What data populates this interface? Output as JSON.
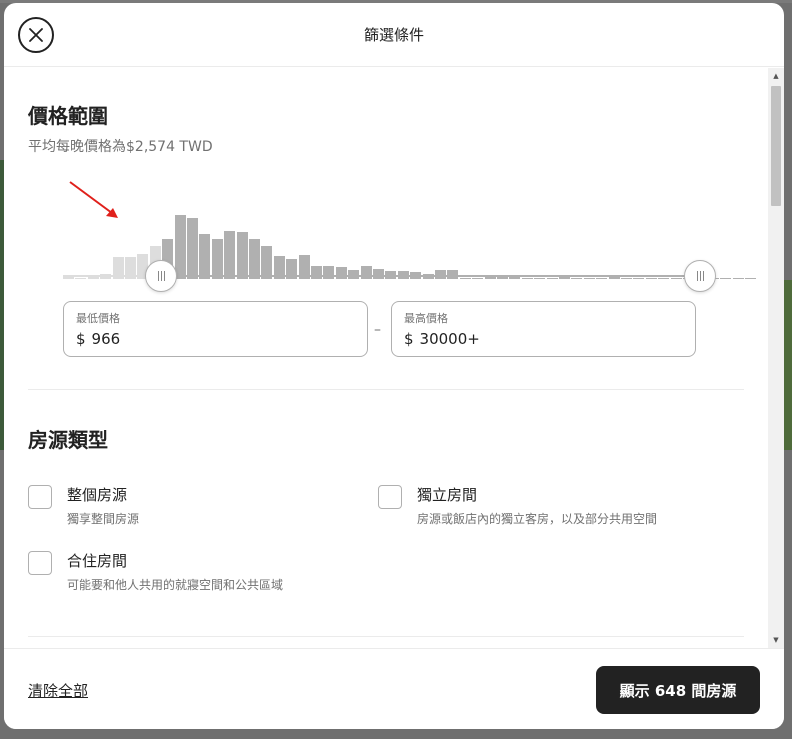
{
  "header": {
    "title": "篩選條件",
    "close_icon": "close-icon"
  },
  "price_range": {
    "title": "價格範圍",
    "subtitle": "平均每晚價格為$2,574 TWD",
    "histogram_heights": [
      2,
      1,
      3,
      5,
      22,
      22,
      25,
      33,
      40,
      64,
      61,
      45,
      40,
      48,
      47,
      40,
      33,
      23,
      20,
      24,
      13,
      13,
      12,
      9,
      13,
      10,
      8,
      8,
      7,
      5,
      9,
      9,
      1,
      1,
      2,
      2,
      3,
      1,
      1,
      1,
      2,
      1,
      1,
      1,
      2,
      1,
      1,
      1,
      1,
      1,
      1,
      1,
      1,
      1,
      1,
      1
    ],
    "histogram_excluded_count": 8,
    "min_label": "最低價格",
    "min_currency": "$",
    "min_value": "966",
    "separator": "–",
    "max_label": "最高價格",
    "max_currency": "$",
    "max_value": "30000+",
    "annotation_color": "#e0201b"
  },
  "property_type": {
    "title": "房源類型",
    "options": [
      {
        "label": "整個房源",
        "description": "獨享整間房源",
        "checked": false
      },
      {
        "label": "獨立房間",
        "description": "房源或飯店內的獨立客房，以及部分共用空間",
        "checked": false
      },
      {
        "label": "合住房間",
        "description": "可能要和他人共用的就寢空間和公共區域",
        "checked": false
      }
    ]
  },
  "footer": {
    "clear_label": "清除全部",
    "show_label": "顯示 648 間房源"
  },
  "colors": {
    "primary_button": "#222222",
    "bar_selected": "#b0b0b0",
    "bar_unselected": "#dddddd"
  }
}
